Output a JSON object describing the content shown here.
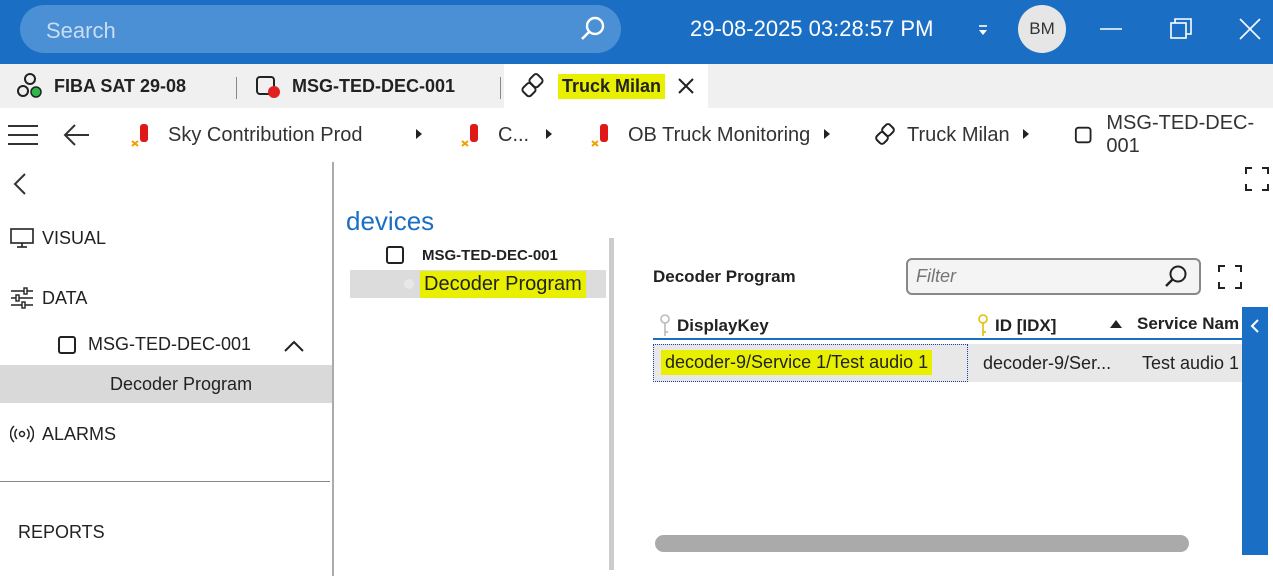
{
  "titlebar": {
    "search_placeholder": "Search",
    "datetime": "29-08-2025 03:28:57 PM",
    "user_initials": "BM",
    "accent_color": "#1a6fc4"
  },
  "tabs": [
    {
      "label": "FIBA SAT 29-08",
      "icon": "element-group-icon"
    },
    {
      "label": "MSG-TED-DEC-001",
      "icon": "element-alarm-icon"
    },
    {
      "label": "Truck Milan",
      "icon": "view-link-icon",
      "active": true
    }
  ],
  "breadcrumb": [
    {
      "label": "Sky Contribution Prod",
      "icon": "critical-view-icon"
    },
    {
      "label": "C...",
      "icon": "critical-view-icon"
    },
    {
      "label": "OB Truck Monitoring",
      "icon": "critical-view-icon"
    },
    {
      "label": "Truck Milan",
      "icon": "view-link-icon"
    },
    {
      "label": "MSG-TED-DEC-001",
      "icon": "element-icon"
    }
  ],
  "nav": {
    "visual": "VISUAL",
    "data": "DATA",
    "device": "MSG-TED-DEC-001",
    "selected_page": "Decoder Program",
    "alarms": "ALARMS",
    "reports": "REPORTS"
  },
  "devices": {
    "title": "devices",
    "device_name": "MSG-TED-DEC-001",
    "selected_item": "Decoder Program"
  },
  "panel": {
    "title": "Decoder Program",
    "filter_placeholder": "Filter",
    "columns": [
      "DisplayKey",
      "ID [IDX]",
      "Service Nam"
    ],
    "rows": [
      {
        "display_key": "decoder-9/Service 1/Test audio 1",
        "id": "decoder-9/Ser...",
        "service_name": "Test audio 1"
      }
    ]
  }
}
